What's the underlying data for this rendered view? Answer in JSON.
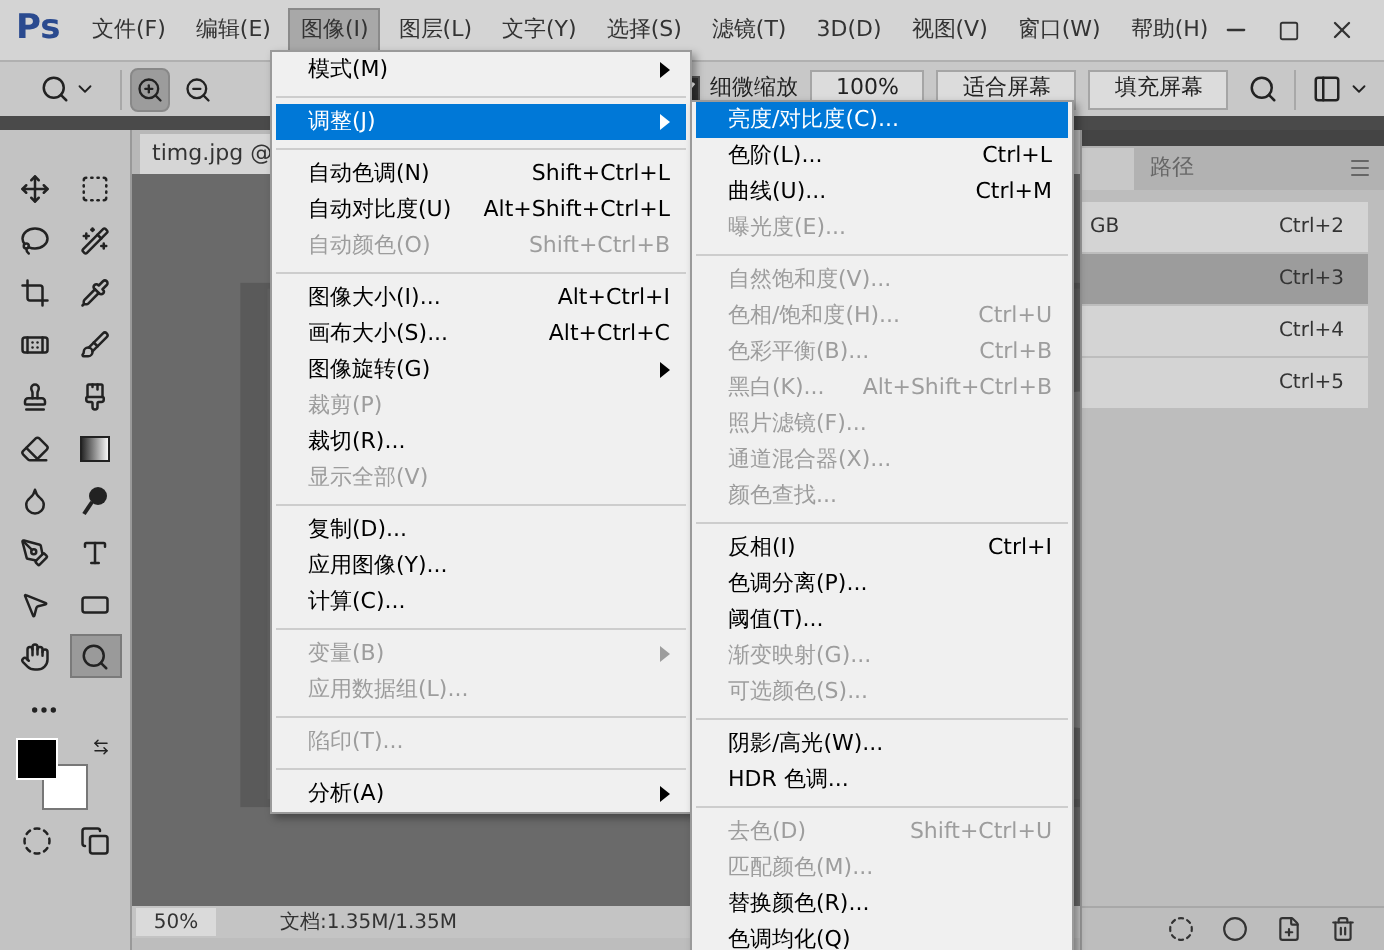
{
  "app": {
    "logo": "Ps"
  },
  "menu_bar": [
    {
      "label": "文件(F)",
      "selected": false
    },
    {
      "label": "编辑(E)",
      "selected": false
    },
    {
      "label": "图像(I)",
      "selected": true
    },
    {
      "label": "图层(L)",
      "selected": false
    },
    {
      "label": "文字(Y)",
      "selected": false
    },
    {
      "label": "选择(S)",
      "selected": false
    },
    {
      "label": "滤镜(T)",
      "selected": false
    },
    {
      "label": "3D(D)",
      "selected": false
    },
    {
      "label": "视图(V)",
      "selected": false
    },
    {
      "label": "窗口(W)",
      "selected": false
    },
    {
      "label": "帮助(H)",
      "selected": false
    }
  ],
  "options_bar": {
    "zoom_modes": [
      {
        "selected": true
      },
      {
        "selected": false
      }
    ],
    "scrubby_zoom": {
      "label": "细微缩放",
      "checked": true
    },
    "buttons": [
      "100%",
      "适合屏幕",
      "填充屏幕"
    ]
  },
  "toolbox": {
    "tools": [
      {
        "selected": false
      },
      {
        "selected": false
      },
      {
        "selected": false
      },
      {
        "selected": false
      },
      {
        "selected": false
      },
      {
        "selected": false
      },
      {
        "selected": false
      },
      {
        "selected": false
      },
      {
        "selected": false
      },
      {
        "selected": false
      },
      {
        "selected": false
      },
      {
        "selected": false
      },
      {
        "selected": false
      },
      {
        "selected": false
      },
      {
        "selected": false
      },
      {
        "selected": false
      },
      {
        "selected": false
      },
      {
        "selected": false
      },
      {
        "selected": false
      },
      {
        "selected": true
      }
    ]
  },
  "document": {
    "tab": "timg.jpg @",
    "zoom": "50%",
    "doc_info": "文档:1.35M/1.35M"
  },
  "channels_panel": {
    "tabs": [
      {
        "selected": true
      },
      {
        "label": "路径",
        "selected": false
      }
    ],
    "rows": [
      {
        "name": "GB",
        "shortcut": "Ctrl+2",
        "selected": false
      },
      {
        "shortcut": "Ctrl+3",
        "selected": true
      },
      {
        "shortcut": "Ctrl+4",
        "selected": false
      },
      {
        "shortcut": "Ctrl+5",
        "selected": false
      }
    ]
  },
  "image_menu": {
    "items": [
      {
        "kind": "item",
        "label": "模式(M)",
        "submenu": true,
        "disabled": false,
        "selected": false
      },
      {
        "kind": "separator"
      },
      {
        "kind": "item",
        "label": "调整(J)",
        "submenu": true,
        "disabled": false,
        "selected": true
      },
      {
        "kind": "separator"
      },
      {
        "kind": "item",
        "label": "自动色调(N)",
        "shortcut": "Shift+Ctrl+L",
        "submenu": false,
        "disabled": false,
        "selected": false
      },
      {
        "kind": "item",
        "label": "自动对比度(U)",
        "shortcut": "Alt+Shift+Ctrl+L",
        "submenu": false,
        "disabled": false,
        "selected": false
      },
      {
        "kind": "item",
        "label": "自动颜色(O)",
        "shortcut": "Shift+Ctrl+B",
        "submenu": false,
        "disabled": true,
        "selected": false
      },
      {
        "kind": "separator"
      },
      {
        "kind": "item",
        "label": "图像大小(I)...",
        "shortcut": "Alt+Ctrl+I",
        "submenu": false,
        "disabled": false,
        "selected": false
      },
      {
        "kind": "item",
        "label": "画布大小(S)...",
        "shortcut": "Alt+Ctrl+C",
        "submenu": false,
        "disabled": false,
        "selected": false
      },
      {
        "kind": "item",
        "label": "图像旋转(G)",
        "submenu": true,
        "disabled": false,
        "selected": false
      },
      {
        "kind": "item",
        "label": "裁剪(P)",
        "submenu": false,
        "disabled": true,
        "selected": false
      },
      {
        "kind": "item",
        "label": "裁切(R)...",
        "submenu": false,
        "disabled": false,
        "selected": false
      },
      {
        "kind": "item",
        "label": "显示全部(V)",
        "submenu": false,
        "disabled": true,
        "selected": false
      },
      {
        "kind": "separator"
      },
      {
        "kind": "item",
        "label": "复制(D)...",
        "submenu": false,
        "disabled": false,
        "selected": false
      },
      {
        "kind": "item",
        "label": "应用图像(Y)...",
        "submenu": false,
        "disabled": false,
        "selected": false
      },
      {
        "kind": "item",
        "label": "计算(C)...",
        "submenu": false,
        "disabled": false,
        "selected": false
      },
      {
        "kind": "separator"
      },
      {
        "kind": "item",
        "label": "变量(B)",
        "submenu": true,
        "disabled": true,
        "selected": false
      },
      {
        "kind": "item",
        "label": "应用数据组(L)...",
        "submenu": false,
        "disabled": true,
        "selected": false
      },
      {
        "kind": "separator"
      },
      {
        "kind": "item",
        "label": "陷印(T)...",
        "submenu": false,
        "disabled": true,
        "selected": false
      },
      {
        "kind": "separator"
      },
      {
        "kind": "item",
        "label": "分析(A)",
        "submenu": true,
        "disabled": false,
        "selected": false
      }
    ]
  },
  "adjustments_submenu": {
    "items": [
      {
        "kind": "item",
        "label": "亮度/对比度(C)...",
        "disabled": false,
        "selected": true
      },
      {
        "kind": "item",
        "label": "色阶(L)...",
        "shortcut": "Ctrl+L",
        "disabled": false,
        "selected": false
      },
      {
        "kind": "item",
        "label": "曲线(U)...",
        "shortcut": "Ctrl+M",
        "disabled": false,
        "selected": false
      },
      {
        "kind": "item",
        "label": "曝光度(E)...",
        "disabled": true,
        "selected": false
      },
      {
        "kind": "separator"
      },
      {
        "kind": "item",
        "label": "自然饱和度(V)...",
        "disabled": true,
        "selected": false
      },
      {
        "kind": "item",
        "label": "色相/饱和度(H)...",
        "shortcut": "Ctrl+U",
        "disabled": true,
        "selected": false
      },
      {
        "kind": "item",
        "label": "色彩平衡(B)...",
        "shortcut": "Ctrl+B",
        "disabled": true,
        "selected": false
      },
      {
        "kind": "item",
        "label": "黑白(K)...",
        "shortcut": "Alt+Shift+Ctrl+B",
        "disabled": true,
        "selected": false
      },
      {
        "kind": "item",
        "label": "照片滤镜(F)...",
        "disabled": true,
        "selected": false
      },
      {
        "kind": "item",
        "label": "通道混合器(X)...",
        "disabled": true,
        "selected": false
      },
      {
        "kind": "item",
        "label": "颜色查找...",
        "disabled": true,
        "selected": false
      },
      {
        "kind": "separator"
      },
      {
        "kind": "item",
        "label": "反相(I)",
        "shortcut": "Ctrl+I",
        "disabled": false,
        "selected": false
      },
      {
        "kind": "item",
        "label": "色调分离(P)...",
        "disabled": false,
        "selected": false
      },
      {
        "kind": "item",
        "label": "阈值(T)...",
        "disabled": false,
        "selected": false
      },
      {
        "kind": "item",
        "label": "渐变映射(G)...",
        "disabled": true,
        "selected": false
      },
      {
        "kind": "item",
        "label": "可选颜色(S)...",
        "disabled": true,
        "selected": false
      },
      {
        "kind": "separator"
      },
      {
        "kind": "item",
        "label": "阴影/高光(W)...",
        "disabled": false,
        "selected": false
      },
      {
        "kind": "item",
        "label": "HDR 色调...",
        "disabled": false,
        "selected": false
      },
      {
        "kind": "separator"
      },
      {
        "kind": "item",
        "label": "去色(D)",
        "shortcut": "Shift+Ctrl+U",
        "disabled": true,
        "selected": false
      },
      {
        "kind": "item",
        "label": "匹配颜色(M)...",
        "disabled": true,
        "selected": false
      },
      {
        "kind": "item",
        "label": "替换颜色(R)...",
        "disabled": false,
        "selected": false
      },
      {
        "kind": "item",
        "label": "色调均化(Q)",
        "disabled": false,
        "selected": false
      }
    ]
  }
}
